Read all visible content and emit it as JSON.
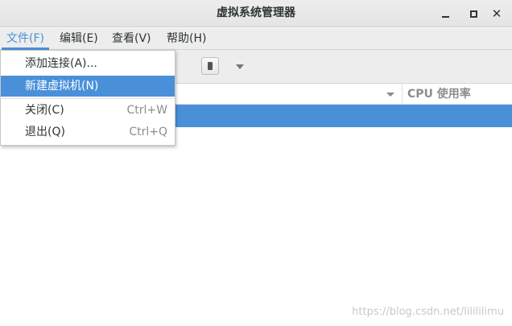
{
  "window": {
    "title": "虚拟系统管理器"
  },
  "menubar": {
    "items": [
      {
        "label": "文件(F)"
      },
      {
        "label": "编辑(E)"
      },
      {
        "label": "查看(V)"
      },
      {
        "label": "帮助(H)"
      }
    ]
  },
  "file_menu": {
    "items": [
      {
        "label": "添加连接(A)...",
        "accel": ""
      },
      {
        "label": "新建虚拟机(N)",
        "accel": ""
      },
      {
        "label": "关闭(C)",
        "accel": "Ctrl+W"
      },
      {
        "label": "退出(Q)",
        "accel": "Ctrl+Q"
      }
    ]
  },
  "list_header": {
    "cpu_label": "CPU 使用率"
  },
  "watermark": "https://blog.csdn.net/lilililimu",
  "colors": {
    "accent": "#4a90d9"
  }
}
